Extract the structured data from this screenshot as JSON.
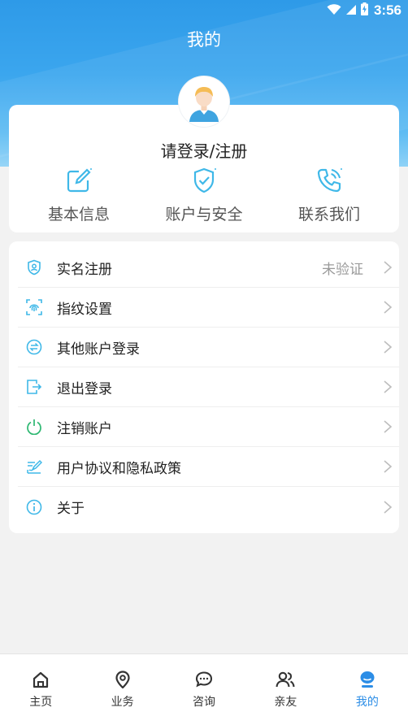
{
  "status_bar": {
    "time": "3:56",
    "battery_icon": "battery-charging-icon",
    "wifi_icon": "wifi-icon",
    "signal_icon": "signal-icon"
  },
  "header": {
    "title": "我的"
  },
  "profile": {
    "login_prompt": "请登录/注册",
    "avatar_icon": "user-avatar-icon"
  },
  "quick_actions": [
    {
      "label": "基本信息",
      "icon": "edit-icon"
    },
    {
      "label": "账户与安全",
      "icon": "shield-check-icon"
    },
    {
      "label": "联系我们",
      "icon": "phone-icon"
    }
  ],
  "menu": [
    {
      "label": "实名注册",
      "value": "未验证",
      "icon": "id-shield-icon"
    },
    {
      "label": "指纹设置",
      "value": "",
      "icon": "fingerprint-icon"
    },
    {
      "label": "其他账户登录",
      "value": "",
      "icon": "switch-account-icon"
    },
    {
      "label": "退出登录",
      "value": "",
      "icon": "logout-icon"
    },
    {
      "label": "注销账户",
      "value": "",
      "icon": "power-icon"
    },
    {
      "label": "用户协议和隐私政策",
      "value": "",
      "icon": "agreement-icon"
    },
    {
      "label": "关于",
      "value": "",
      "icon": "info-icon"
    }
  ],
  "tabbar": [
    {
      "label": "主页",
      "icon": "home-icon",
      "active": false
    },
    {
      "label": "业务",
      "icon": "location-icon",
      "active": false
    },
    {
      "label": "咨询",
      "icon": "chat-icon",
      "active": false
    },
    {
      "label": "亲友",
      "icon": "friends-icon",
      "active": false
    },
    {
      "label": "我的",
      "icon": "profile-icon",
      "active": true
    }
  ],
  "colors": {
    "primary": "#2c8de6",
    "icon_cyan": "#3fb8e8",
    "icon_green": "#2eb872"
  }
}
